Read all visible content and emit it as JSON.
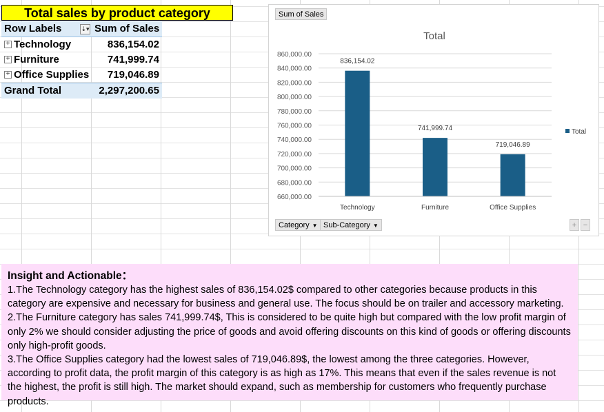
{
  "sheet": {
    "title": "Total sales by product category"
  },
  "pivot": {
    "row_labels_header": "Row Labels",
    "sum_header": "Sum of Sales",
    "rows": [
      {
        "label": "Technology",
        "value": "836,154.02"
      },
      {
        "label": "Furniture",
        "value": "741,999.74"
      },
      {
        "label": "Office Supplies",
        "value": "719,046.89"
      }
    ],
    "grand_total_label": "Grand Total",
    "grand_total_value": "2,297,200.65"
  },
  "chart_ui": {
    "value_button": "Sum of Sales",
    "axis_button_1": "Category",
    "axis_button_2": "Sub-Category",
    "plus": "+",
    "minus": "−"
  },
  "chart_data": {
    "type": "bar",
    "title": "Total",
    "categories": [
      "Technology",
      "Furniture",
      "Office Supplies"
    ],
    "series": [
      {
        "name": "Total",
        "values": [
          836154.02,
          741999.74,
          719046.89
        ],
        "color": "#1a5e87"
      }
    ],
    "data_labels": [
      "836,154.02",
      "741,999.74",
      "719,046.89"
    ],
    "ylim": [
      660000,
      860000
    ],
    "yticks": [
      660000,
      680000,
      700000,
      720000,
      740000,
      760000,
      780000,
      800000,
      820000,
      840000,
      860000
    ],
    "ytick_labels": [
      "660,000.00",
      "680,000.00",
      "700,000.00",
      "720,000.00",
      "740,000.00",
      "760,000.00",
      "780,000.00",
      "800,000.00",
      "820,000.00",
      "840,000.00",
      "860,000.00"
    ],
    "grid": true,
    "legend": "right"
  },
  "insight": {
    "heading": "Insight and Actionable：",
    "paragraphs": [
      "1.The Technology category has the highest sales of 836,154.02$ compared to other categories  because products in this category are expensive and  necessary for business and general use.  The focus should be on trailer and accessory marketing.",
      "2.The Furniture category  has sales 741,999.74$, This is considered to be quite high but compared with the low profit margin of only 2% we should consider adjusting the price of goods and avoid offering discounts on this kind of goods or offering discounts only high-profit goods.",
      "3.The Office Supplies category had the lowest sales of 719,046.89$,  the lowest among the three categories. However, according to profit data, the profit margin of this category is as high as 17%. This means that even if the sales revenue is not the highest, the profit is still high. The market should expand, such as membership for customers who frequently purchase products."
    ]
  }
}
